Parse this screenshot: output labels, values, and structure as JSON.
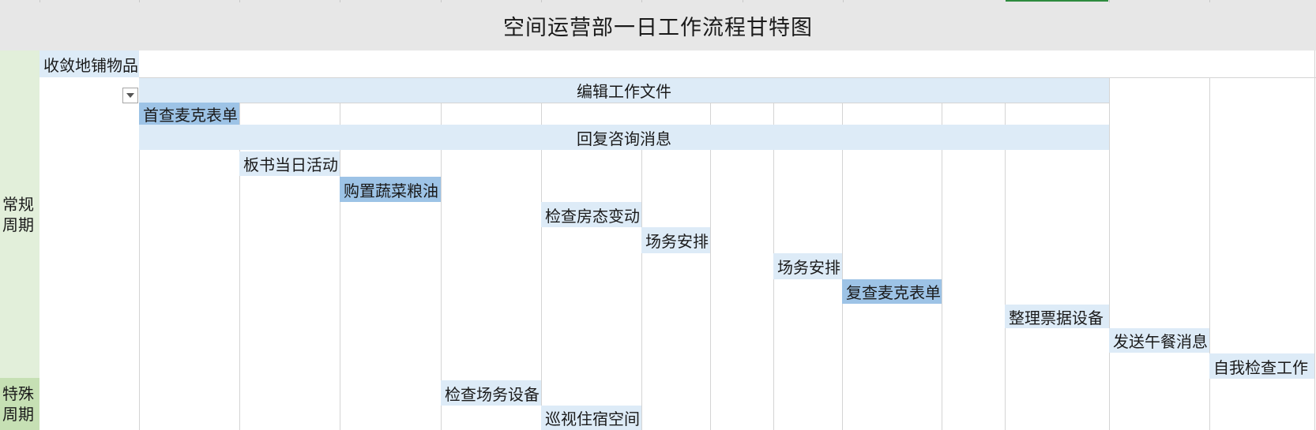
{
  "title": "空间运营部一日工作流程甘特图",
  "categories": {
    "regular": "常规\n周期",
    "special": "特殊\n周期"
  },
  "tasks": {
    "t1": "收敛地铺物品",
    "t2": "编辑工作文件",
    "t3": "首查麦克表单",
    "t4": "回复咨询消息",
    "t5": "板书当日活动",
    "t6": "购置蔬菜粮油",
    "t7": "检查房态变动",
    "t8": "场务安排",
    "t9": "场务安排",
    "t10": "复查麦克表单",
    "t11": "整理票据设备",
    "t12": "发送午餐消息",
    "t13": "自我检查工作",
    "t14": "检查场务设备",
    "t15": "巡视住宿空间"
  },
  "colors": {
    "light_task": "#ddebf7",
    "highlight_task": "#9dc3e6",
    "regular_category": "#e2efda",
    "special_category": "#c6e0b4",
    "title_bg": "#e7e7e7",
    "selected_column_marker": "#2e8b3e"
  },
  "icons": {
    "filter": "dropdown-arrow-icon"
  }
}
